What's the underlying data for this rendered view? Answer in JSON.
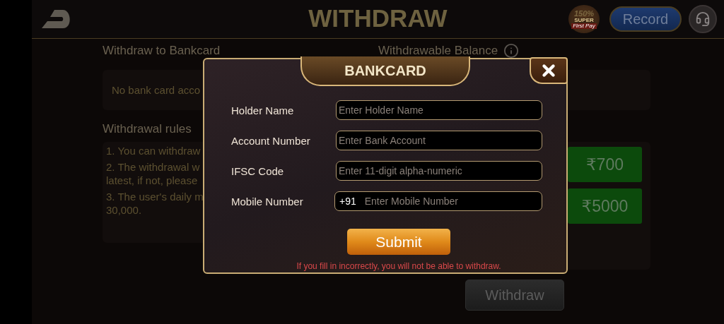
{
  "header": {
    "title": "WITHDRAW",
    "badge": {
      "percent": "150%",
      "tag": "SUPER",
      "caption": "First Pay"
    },
    "record_button": "Record"
  },
  "bankcard_section": {
    "label": "Withdraw to Bankcard",
    "balance_label": "Withdrawable Balance",
    "empty_message": "No bank card acco"
  },
  "rules": {
    "title": "Withdrawal rules",
    "items": [
      {
        "lines": [
          "1. You can withdraw"
        ]
      },
      {
        "lines": [
          "2. The withdrawal w",
          "latest, if not, please"
        ]
      },
      {
        "lines": [
          "3. The user's daily m",
          "30,000."
        ]
      }
    ]
  },
  "amounts": [
    {
      "label": "₹700"
    },
    {
      "label": "₹5000"
    }
  ],
  "withdraw_button": {
    "label": "Withdraw",
    "disabled": true
  },
  "dialog": {
    "title": "BANKCARD",
    "fields": [
      {
        "kind": "text",
        "label": "Holder Name",
        "placeholder": "Enter Holder Name"
      },
      {
        "kind": "text",
        "label": "Account Number",
        "placeholder": "Enter Bank Account"
      },
      {
        "kind": "text",
        "label": "IFSC Code",
        "placeholder": "Enter 11-digit alpha-numeric"
      },
      {
        "kind": "phone",
        "label": "Mobile Number",
        "prefix": "+91",
        "placeholder": "Enter Mobile Number"
      }
    ],
    "submit": "Submit",
    "warning": "If you fill in incorrectly, you will not be able to withdraw."
  }
}
